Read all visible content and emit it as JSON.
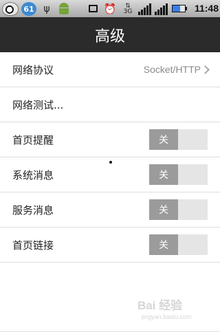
{
  "status_bar": {
    "notification_count": "61",
    "network_type": "3G",
    "time": "11:48",
    "icons": [
      "weibo-icon",
      "notification-badge",
      "usb-icon",
      "android-icon",
      "screen-icon",
      "alarm-icon",
      "3g-icon",
      "signal-icon",
      "battery-icon"
    ]
  },
  "title_bar": {
    "title": "高级"
  },
  "settings": {
    "network_protocol": {
      "label": "网络协议",
      "value": "Socket/HTTP"
    },
    "network_test": {
      "label": "网络测试..."
    },
    "homepage_reminder": {
      "label": "首页提醒",
      "toggle": "关"
    },
    "system_messages": {
      "label": "系统消息",
      "toggle": "关"
    },
    "service_messages": {
      "label": "服务消息",
      "toggle": "关"
    },
    "homepage_links": {
      "label": "首页链接",
      "toggle": "关"
    }
  },
  "watermark": {
    "text": "Bai 经验",
    "url": "jingyan.baidu.com"
  },
  "colors": {
    "title_bar_bg": "#2b2b2b",
    "toggle_off": "#9b9b9b",
    "toggle_track": "#e5e5e5"
  }
}
